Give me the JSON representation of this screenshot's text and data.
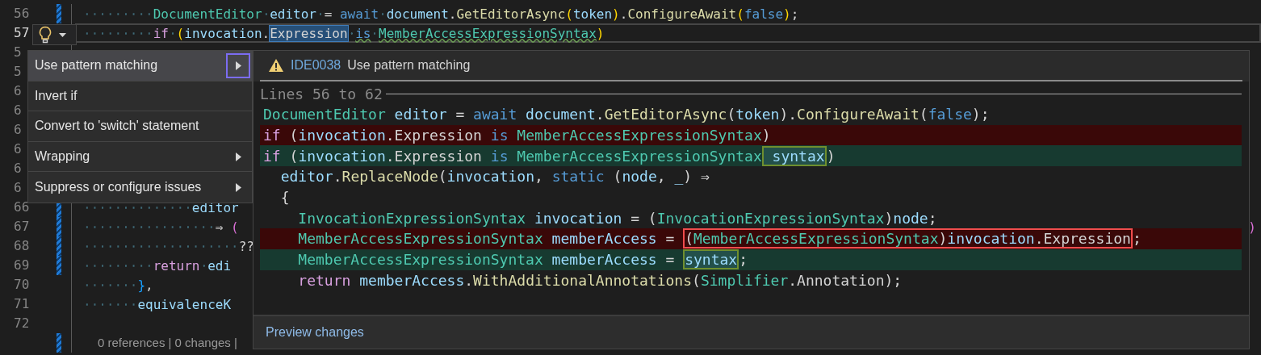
{
  "editor": {
    "lines": [
      {
        "number": "56",
        "modified": true,
        "current": false,
        "segments": [
          {
            "text": "         DocumentEditor",
            "kind": "type"
          },
          {
            "text": " editor",
            "kind": "variable"
          },
          {
            "text": " = ",
            "kind": "plain"
          },
          {
            "text": "await",
            "kind": "keyword"
          },
          {
            "text": " document",
            "kind": "variable"
          },
          {
            "text": ".",
            "kind": "plain"
          },
          {
            "text": "GetEditorAsync",
            "kind": "method"
          },
          {
            "text": "(",
            "kind": "paren"
          },
          {
            "text": "token",
            "kind": "variable"
          },
          {
            "text": ")",
            "kind": "paren"
          },
          {
            "text": ".",
            "kind": "plain"
          },
          {
            "text": "ConfigureAwait",
            "kind": "method"
          },
          {
            "text": "(",
            "kind": "paren"
          },
          {
            "text": "false",
            "kind": "keyword"
          },
          {
            "text": ")",
            "kind": "paren"
          },
          {
            "text": ";",
            "kind": "plain"
          }
        ]
      },
      {
        "number": "57",
        "current": true,
        "segments": [
          {
            "text": "         if",
            "kind": "control"
          },
          {
            "text": " (",
            "kind": "paren"
          },
          {
            "text": "invocation",
            "kind": "variable"
          },
          {
            "text": ".",
            "kind": "plain"
          },
          {
            "text": "Expression",
            "kind": "plain",
            "selected": true,
            "squiggle": true
          },
          {
            "text": " is",
            "kind": "keyword",
            "selected": false,
            "squiggle": true
          },
          {
            "text": " MemberAccessExpressionSyntax",
            "kind": "type",
            "selected": false,
            "squiggle": true
          },
          {
            "text": ")",
            "kind": "paren"
          }
        ]
      },
      {
        "number": "5"
      },
      {
        "number": "5"
      },
      {
        "number": "6"
      },
      {
        "number": "6"
      },
      {
        "number": "6"
      },
      {
        "number": "6"
      },
      {
        "number": "6"
      },
      {
        "number": "6"
      },
      {
        "number": "66",
        "modified": true,
        "current": false,
        "segments": [
          {
            "text": "              editor",
            "kind": "variable"
          }
        ]
      },
      {
        "number": "67",
        "modified": true,
        "current": false,
        "segments": [
          {
            "text": "                 ⇒ ",
            "kind": "plain"
          },
          {
            "text": "(",
            "kind": "paren2"
          }
        ],
        "tail": {
          "text": ")",
          "kind": "paren2"
        }
      },
      {
        "number": "68",
        "modified": true,
        "current": false,
        "segments": [
          {
            "text": "                    ??",
            "kind": "plain"
          }
        ]
      },
      {
        "number": "69",
        "modified": true,
        "current": false,
        "segments": [
          {
            "text": "         return",
            "kind": "control"
          },
          {
            "text": " edi",
            "kind": "variable"
          }
        ]
      },
      {
        "number": "70",
        "modified": false,
        "current": false,
        "segments": [
          {
            "text": "       }",
            "kind": "paren3"
          },
          {
            "text": ",",
            "kind": "plain"
          }
        ]
      },
      {
        "number": "71",
        "modified": false,
        "current": false,
        "segments": [
          {
            "text": "       equivalenceK",
            "kind": "variable"
          }
        ]
      },
      {
        "number": "72",
        "modified": false,
        "current": false
      }
    ],
    "codelens": {
      "text": "0 references | 0 changes |",
      "modified": true
    }
  },
  "quick_actions_menu": {
    "items": [
      {
        "label": "Use pattern matching",
        "selected": true,
        "has_submenu": true
      },
      {
        "label": "Invert if",
        "selected": false,
        "has_submenu": false
      },
      {
        "label": "Convert to 'switch' statement",
        "selected": false,
        "has_submenu": false
      },
      {
        "label": "Wrapping",
        "selected": false,
        "has_submenu": true
      },
      {
        "label": "Suppress or configure issues",
        "selected": false,
        "has_submenu": true
      }
    ]
  },
  "preview": {
    "diagnostic_id": "IDE0038",
    "title": "Use pattern matching",
    "range_label": "Lines 56 to 62",
    "lines": [
      {
        "kind": "context",
        "segments": [
          {
            "text": "DocumentEditor",
            "kind": "type"
          },
          {
            "text": " editor",
            "kind": "variable"
          },
          {
            "text": " = ",
            "kind": "plain"
          },
          {
            "text": "await",
            "kind": "keyword"
          },
          {
            "text": " document",
            "kind": "variable"
          },
          {
            "text": ".",
            "kind": "plain"
          },
          {
            "text": "GetEditorAsync",
            "kind": "method"
          },
          {
            "text": "(",
            "kind": "plain"
          },
          {
            "text": "token",
            "kind": "variable"
          },
          {
            "text": ").",
            "kind": "plain"
          },
          {
            "text": "ConfigureAwait",
            "kind": "method"
          },
          {
            "text": "(",
            "kind": "plain"
          },
          {
            "text": "false",
            "kind": "keyword"
          },
          {
            "text": ");",
            "kind": "plain"
          }
        ]
      },
      {
        "kind": "removed",
        "segments": [
          {
            "text": "if",
            "kind": "control"
          },
          {
            "text": " (",
            "kind": "plain"
          },
          {
            "text": "invocation",
            "kind": "variable"
          },
          {
            "text": ".Expression ",
            "kind": "plain"
          },
          {
            "text": "is",
            "kind": "keyword"
          },
          {
            "text": " MemberAccessExpressionSyntax",
            "kind": "type"
          },
          {
            "text": ")",
            "kind": "plain"
          }
        ]
      },
      {
        "kind": "added",
        "segments": [
          {
            "text": "if",
            "kind": "control"
          },
          {
            "text": " (",
            "kind": "plain"
          },
          {
            "text": "invocation",
            "kind": "variable"
          },
          {
            "text": ".Expression ",
            "kind": "plain"
          },
          {
            "text": "is",
            "kind": "keyword"
          },
          {
            "text": " MemberAccessExpressionSyntax",
            "kind": "type"
          },
          {
            "kind": "added",
            "segments": [
              {
                "text": " syntax",
                "kind": "variable"
              }
            ]
          },
          {
            "text": ")",
            "kind": "plain"
          }
        ]
      },
      {
        "kind": "context",
        "segments": [
          {
            "text": "  editor",
            "kind": "variable"
          },
          {
            "text": ".",
            "kind": "plain"
          },
          {
            "text": "ReplaceNode",
            "kind": "method"
          },
          {
            "text": "(",
            "kind": "plain"
          },
          {
            "text": "invocation",
            "kind": "variable"
          },
          {
            "text": ", ",
            "kind": "plain"
          },
          {
            "text": "static",
            "kind": "keyword"
          },
          {
            "text": " (",
            "kind": "plain"
          },
          {
            "text": "node",
            "kind": "variable"
          },
          {
            "text": ", ",
            "kind": "plain"
          },
          {
            "text": "_",
            "kind": "variable"
          },
          {
            "text": ") ⇒",
            "kind": "plain"
          }
        ]
      },
      {
        "kind": "context",
        "segments": [
          {
            "text": "  {",
            "kind": "plain"
          }
        ]
      },
      {
        "kind": "context",
        "segments": [
          {
            "text": "    InvocationExpressionSyntax",
            "kind": "type"
          },
          {
            "text": " invocation",
            "kind": "variable"
          },
          {
            "text": " = (",
            "kind": "plain"
          },
          {
            "text": "InvocationExpressionSyntax",
            "kind": "type"
          },
          {
            "text": ")",
            "kind": "plain"
          },
          {
            "text": "node",
            "kind": "variable"
          },
          {
            "text": ";",
            "kind": "plain"
          }
        ]
      },
      {
        "kind": "removed",
        "segments": [
          {
            "text": "    MemberAccessExpressionSyntax",
            "kind": "type"
          },
          {
            "text": " memberAccess",
            "kind": "variable"
          },
          {
            "text": " = ",
            "kind": "plain"
          },
          {
            "kind": "removed",
            "segments": [
              {
                "text": "(",
                "kind": "plain"
              },
              {
                "text": "MemberAccessExpressionSyntax",
                "kind": "type"
              },
              {
                "text": ")",
                "kind": "plain"
              },
              {
                "text": "invocation",
                "kind": "variable"
              },
              {
                "text": ".Expression",
                "kind": "plain"
              }
            ]
          },
          {
            "text": ";",
            "kind": "plain"
          }
        ]
      },
      {
        "kind": "added",
        "segments": [
          {
            "text": "    MemberAccessExpressionSyntax",
            "kind": "type"
          },
          {
            "text": " memberAccess",
            "kind": "variable"
          },
          {
            "text": " = ",
            "kind": "plain"
          },
          {
            "kind": "added",
            "segments": [
              {
                "text": "syntax",
                "kind": "variable"
              }
            ]
          },
          {
            "text": ";",
            "kind": "plain"
          }
        ]
      },
      {
        "kind": "context",
        "segments": [
          {
            "text": "    return",
            "kind": "control"
          },
          {
            "text": " memberAccess",
            "kind": "variable"
          },
          {
            "text": ".",
            "kind": "plain"
          },
          {
            "text": "WithAdditionalAnnotations",
            "kind": "method"
          },
          {
            "text": "(",
            "kind": "plain"
          },
          {
            "text": "Simplifier",
            "kind": "type"
          },
          {
            "text": ".Annotation);",
            "kind": "plain"
          }
        ]
      }
    ],
    "action": "Preview changes"
  }
}
